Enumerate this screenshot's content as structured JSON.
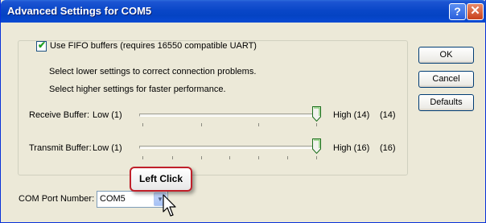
{
  "window": {
    "title": "Advanced Settings for COM5",
    "help_glyph": "?",
    "close_glyph": "✕"
  },
  "fifo": {
    "checkbox_label": "Use FIFO buffers (requires 16550 compatible UART)",
    "checked": true,
    "hint_lower": "Select lower settings to correct connection problems.",
    "hint_higher": "Select higher settings for faster performance."
  },
  "receive": {
    "label": "Receive Buffer:",
    "low": "Low (1)",
    "high": "High (14)",
    "value_text": "(14)",
    "level": 1.0
  },
  "transmit": {
    "label": "Transmit Buffer:",
    "low": "Low (1)",
    "high": "High (16)",
    "value_text": "(16)",
    "level": 1.0
  },
  "buttons": {
    "ok": "OK",
    "cancel": "Cancel",
    "defaults": "Defaults"
  },
  "com_port": {
    "label": "COM Port Number:",
    "value": "COM5"
  },
  "annotation": {
    "callout": "Left Click"
  },
  "colors": {
    "titlebar": "#0a47c8",
    "callout_border": "#c0202a",
    "dialog_bg": "#ece9d8"
  }
}
